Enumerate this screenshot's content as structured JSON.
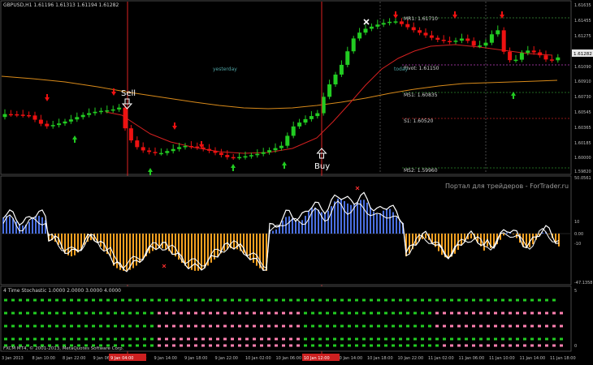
{
  "main_chart": {
    "title": "GBPUSD,H1  1.61196 1.61313 1.61194 1.61282",
    "price_scale": [
      "1.61635",
      "1.61455",
      "1.61275",
      "1.61090",
      "1.60910",
      "1.60730",
      "1.60545",
      "1.60365",
      "1.60185",
      "1.60000",
      "1.59820",
      "1.59670"
    ],
    "current_price": "1.61282",
    "pivot_levels": [
      {
        "label": "MR1: 1.61710",
        "color": "#3a8f3a"
      },
      {
        "label": "Pivot: 1.61150",
        "color": "#c040c0"
      },
      {
        "label": "MS1: 1.60835",
        "color": "#2a8a2a"
      },
      {
        "label": "S1: 1.60520",
        "color": "#c02020"
      },
      {
        "label": "MS2: 1.59960",
        "color": "#2a8a2a"
      }
    ],
    "session_labels": {
      "yesterday": "yesterday",
      "today": "today"
    },
    "signals": {
      "sell": "Sell",
      "buy": "Buy"
    },
    "colors": {
      "bull": "#22cc22",
      "bear": "#ee1111",
      "up_arrow": "#22cc22",
      "down_arrow": "#ee1111"
    }
  },
  "oscillator": {
    "watermark": "Портал для трейдеров - ForTrader.ru",
    "scale": [
      "50.0561",
      "10",
      "0.00",
      "-10",
      "-47.1358"
    ],
    "colors": {
      "positive": "#4a6fe0",
      "negative": "#f4a020",
      "line": "#ffffff"
    }
  },
  "stochastic": {
    "title": "4 Time Stochastic 1.0000 2.0000 3.0000 4.0000",
    "scale": [
      "5",
      "0"
    ],
    "colors": {
      "green": "#22cc22",
      "pink": "#ff80b0"
    },
    "rows": [
      "gggggggggggggggggggggggggggggggggggggggggggggggggggggggggggggggggggggggggggg",
      "gggggggggggggggggggggppppppppppppppppppppggggggggggggggggggppppppppppppppppppp",
      "gggggggggggggggggggggppppppppppppppppppppggggggggggggggggggppppppppppppppppppp",
      "gggggggggggggggggggggppppppppppppppppppppgggggggggggggggggggggggggggggggggggggg",
      "gggggggggggggggggggggppppppppppppppppppppgggggggggggggggggggppppppppppppppppppp"
    ]
  },
  "footer": {
    "copyright": "FXCM MT4, © 2001-2013, MetaQuotes Software Corp.",
    "time_axis": [
      "3 Jan 2013",
      "8 Jan 10:00",
      "8 Jan 22:00",
      "9 Jan 06:00",
      "9 Jan 10:00",
      "9 Jan 14:00",
      "9 Jan 18:00",
      "9 Jan 22:00",
      "10 Jan 02:00",
      "10 Jan 06:00",
      "10 Jan 10:00",
      "10 Jan 14:00",
      "10 Jan 18:00",
      "10 Jan 22:00",
      "11 Jan 02:00",
      "11 Jan 06:00",
      "11 Jan 10:00",
      "11 Jan 14:00",
      "11 Jan 18:00"
    ],
    "highlight_labels": [
      "9 Jan 04:00",
      "10 Jan 12:00"
    ]
  }
}
